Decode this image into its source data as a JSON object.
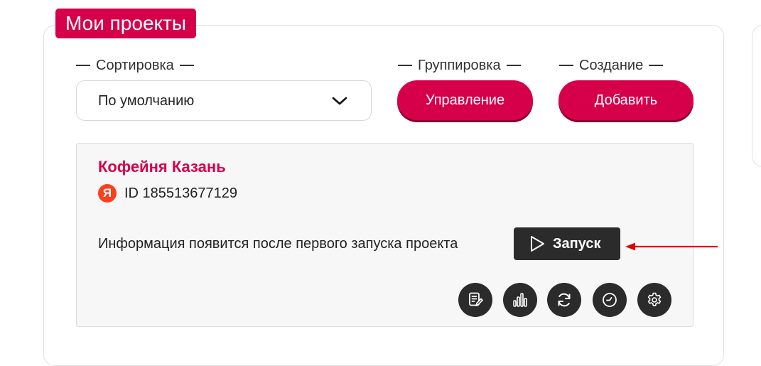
{
  "page": {
    "title": "Мои проекты"
  },
  "controls": {
    "sort": {
      "label": "Сортировка",
      "selected": "По умолчанию"
    },
    "group": {
      "label": "Группировка",
      "button_label": "Управление"
    },
    "create": {
      "label": "Создание",
      "button_label": "Добавить"
    }
  },
  "project": {
    "name": "Кофейня Казань",
    "source_letter": "Я",
    "id_text": "ID 185513677129",
    "info_text": "Информация появится после первого запуска проекта",
    "launch_label": "Запуск",
    "actions": [
      {
        "icon": "report-edit-icon"
      },
      {
        "icon": "bar-chart-icon"
      },
      {
        "icon": "refresh-icon"
      },
      {
        "icon": "clock-icon"
      },
      {
        "icon": "gear-icon"
      }
    ]
  },
  "colors": {
    "accent": "#d6004a",
    "dark_button": "#2b2b2b",
    "card_bg": "#f7f7f7",
    "yandex": "#fc3f1d",
    "arrow": "#e00000"
  }
}
